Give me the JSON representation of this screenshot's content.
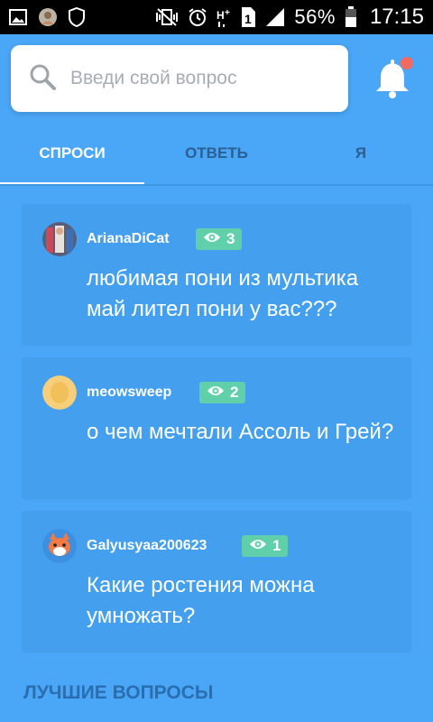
{
  "status_bar": {
    "battery_percent": "56%",
    "time": "17:15",
    "icons": [
      "image-icon",
      "avatar-icon",
      "shield-icon",
      "vibrate-mute-icon",
      "alarm-icon",
      "hplus-icon",
      "sim-1-icon",
      "signal-icon",
      "battery-icon"
    ]
  },
  "search": {
    "placeholder": "Введи свой вопрос"
  },
  "notifications": {
    "has_unread": true,
    "badge_color": "#f26a5d"
  },
  "tabs": [
    {
      "label": "СПРОСИ",
      "active": true
    },
    {
      "label": "ОТВЕТЬ",
      "active": false
    },
    {
      "label": "Я",
      "active": false
    }
  ],
  "questions": [
    {
      "username": "ArianaDiCat",
      "views": "3",
      "text": "любимая пони из мультика май лител пони у вас???"
    },
    {
      "username": "meowsweep",
      "views": "2",
      "text": "о чем мечтали Ассоль и Грей?"
    },
    {
      "username": "Galyusyaa200623",
      "views": "1",
      "text": "Какие ростения можна умножать?"
    }
  ],
  "sections": {
    "best_questions": "ЛУЧШИЕ ВОПРОСЫ"
  },
  "colors": {
    "background": "#4aa6f6",
    "card": "#44a0ee",
    "views_badge": "#5fd0a9",
    "tab_inactive": "#2a5f93",
    "section_title": "#2a6eb0"
  }
}
